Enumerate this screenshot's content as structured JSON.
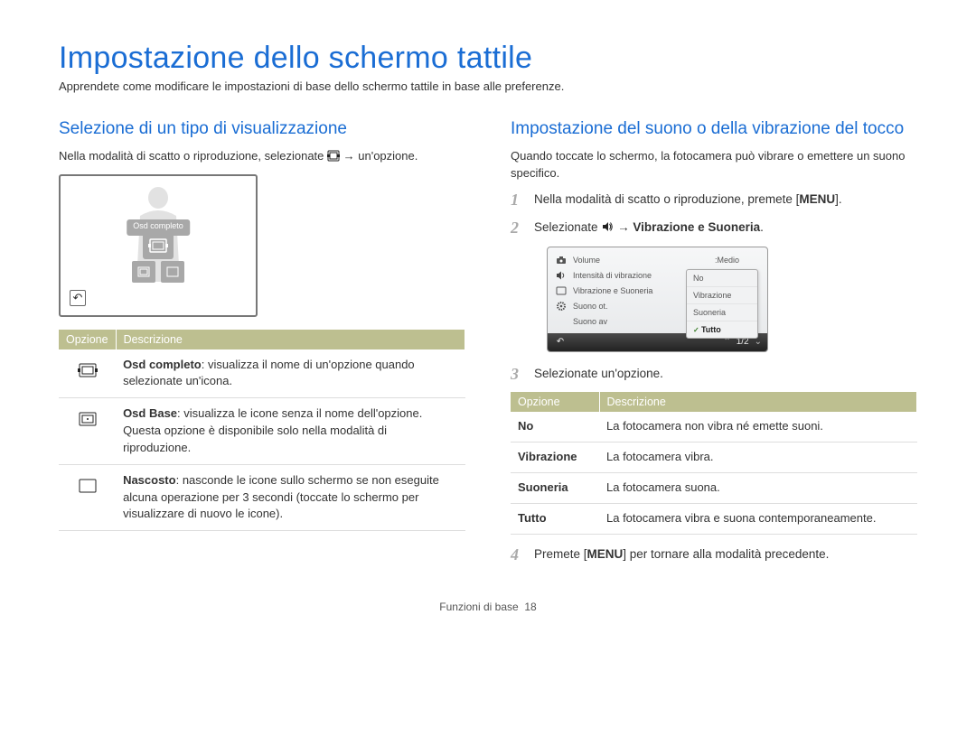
{
  "page": {
    "title": "Impostazione dello schermo tattile",
    "subtitle": "Apprendete come modificare le impostazioni di base dello schermo tattile in base alle preferenze.",
    "footer_section": "Funzioni di base",
    "footer_page": "18"
  },
  "left": {
    "heading": "Selezione di un tipo di visualizzazione",
    "intro_a": "Nella modalità di scatto o riproduzione, selezionate ",
    "intro_b": " → un'opzione.",
    "demo_label": "Osd completo",
    "table_headers": {
      "opt": "Opzione",
      "desc": "Descrizione"
    },
    "rows": [
      {
        "title": "Osd completo",
        "desc": ": visualizza il nome di un'opzione quando selezionate un'icona."
      },
      {
        "title": "Osd Base",
        "desc": ": visualizza le icone senza il nome dell'opzione. Questa opzione è disponibile solo nella modalità di riproduzione."
      },
      {
        "title": "Nascosto",
        "desc": ": nasconde le icone sullo schermo se non eseguite alcuna operazione per 3 secondi (toccate lo schermo per visualizzare di nuovo le icone)."
      }
    ]
  },
  "right": {
    "heading": "Impostazione del suono o della vibrazione del tocco",
    "intro": "Quando toccate lo schermo, la fotocamera può vibrare o emettere un suono specifico.",
    "step1_a": "Nella modalità di scatto o riproduzione, premete [",
    "step1_menu": "MENU",
    "step1_b": "].",
    "step2_a": "Selezionate ",
    "step2_arrow": " → ",
    "step2_bold": "Vibrazione e Suoneria",
    "menu_ui": {
      "items": [
        {
          "label": "Volume",
          "value": ":Medio"
        },
        {
          "label": "Intensità di vibrazione",
          "value": ""
        },
        {
          "label": "Vibrazione e Suoneria",
          "value": ""
        },
        {
          "label": "Suono ot.",
          "value": ""
        },
        {
          "label": "Suono av",
          "value": ""
        }
      ],
      "dropdown": [
        "No",
        "Vibrazione",
        "Suoneria",
        "Tutto"
      ],
      "pager": "1/2"
    },
    "step3": "Selezionate un'opzione.",
    "table_headers": {
      "opt": "Opzione",
      "desc": "Descrizione"
    },
    "rows": [
      {
        "name": "No",
        "desc": "La fotocamera non vibra né emette suoni."
      },
      {
        "name": "Vibrazione",
        "desc": "La fotocamera vibra."
      },
      {
        "name": "Suoneria",
        "desc": "La fotocamera suona."
      },
      {
        "name": "Tutto",
        "desc": "La fotocamera vibra e suona contemporaneamente."
      }
    ],
    "step4_a": "Premete [",
    "step4_menu": "MENU",
    "step4_b": "] per tornare alla modalità precedente."
  }
}
